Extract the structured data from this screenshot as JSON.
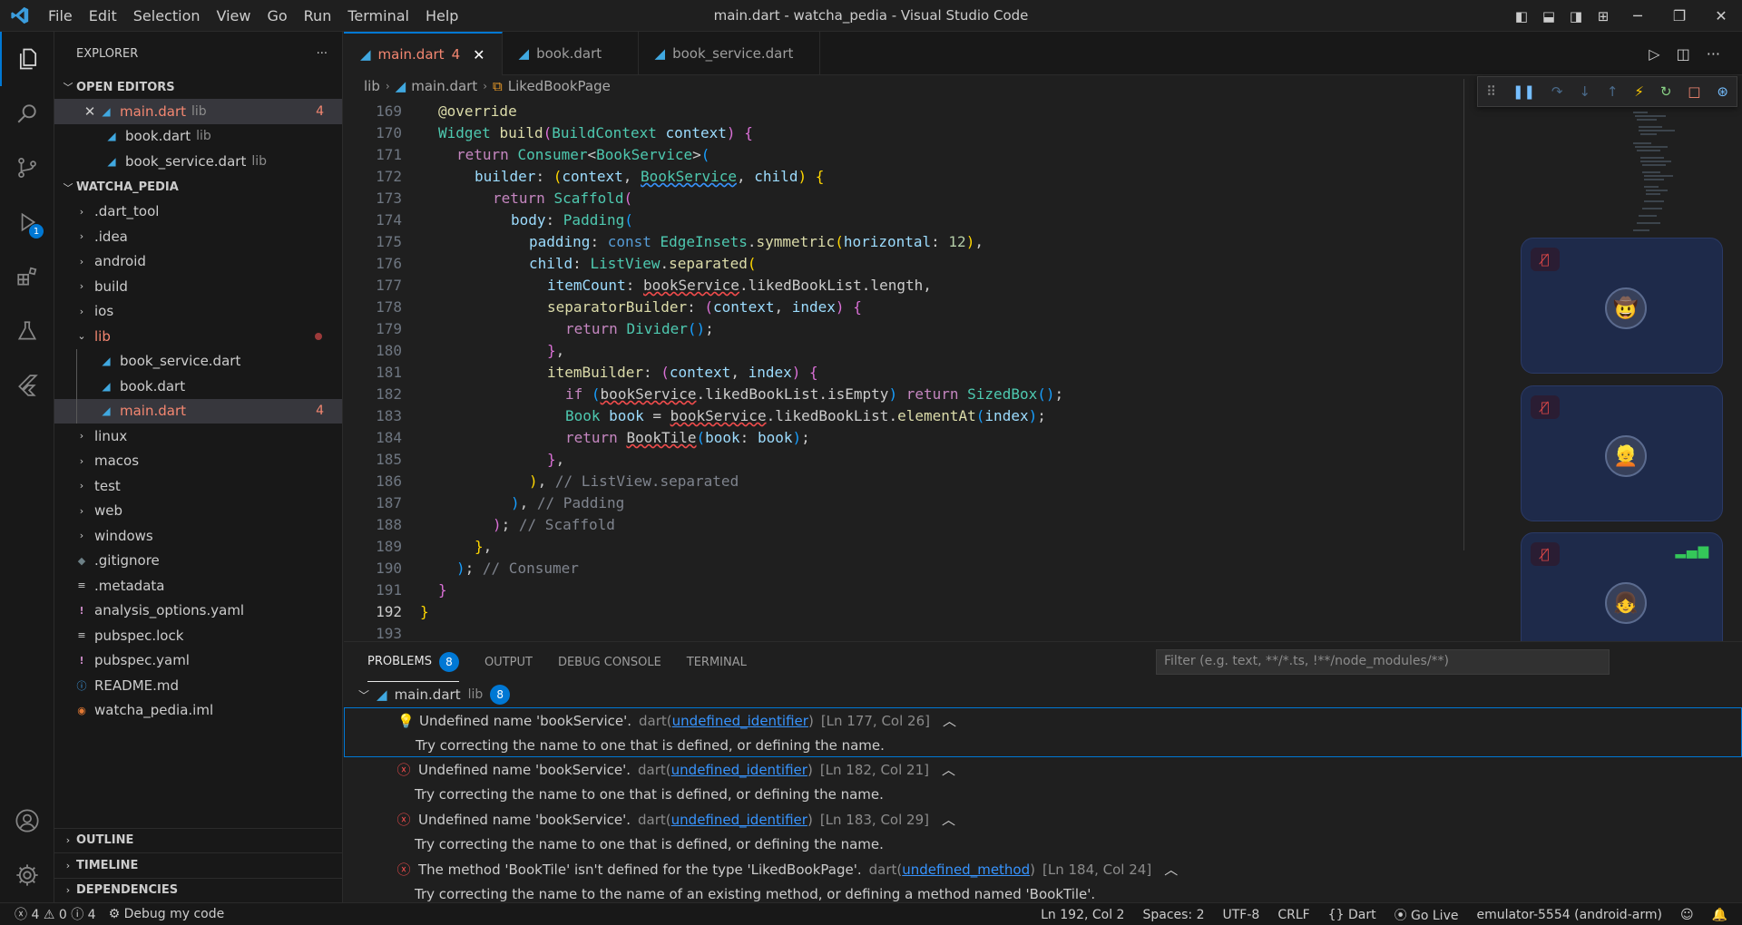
{
  "window": {
    "title": "main.dart - watcha_pedia - Visual Studio Code",
    "menu": [
      "File",
      "Edit",
      "Selection",
      "View",
      "Go",
      "Run",
      "Terminal",
      "Help"
    ]
  },
  "activity": {
    "debug_badge": "1"
  },
  "explorer": {
    "header": "EXPLORER",
    "more": "···",
    "open_editors": {
      "title": "OPEN EDITORS",
      "items": [
        {
          "name": "main.dart",
          "dir": "lib",
          "count": "4",
          "state": "error"
        },
        {
          "name": "book.dart",
          "dir": "lib"
        },
        {
          "name": "book_service.dart",
          "dir": "lib"
        }
      ]
    },
    "project": {
      "title": "WATCHA_PEDIA",
      "items": [
        {
          "name": ".dart_tool"
        },
        {
          "name": ".idea"
        },
        {
          "name": "android"
        },
        {
          "name": "build"
        },
        {
          "name": "ios"
        },
        {
          "name": "lib"
        },
        {
          "name": "book_service.dart"
        },
        {
          "name": "book.dart"
        },
        {
          "name": "main.dart",
          "count": "4"
        },
        {
          "name": "linux"
        },
        {
          "name": "macos"
        },
        {
          "name": "test"
        },
        {
          "name": "web"
        },
        {
          "name": "windows"
        },
        {
          "name": ".gitignore"
        },
        {
          "name": ".metadata"
        },
        {
          "name": "analysis_options.yaml"
        },
        {
          "name": "pubspec.lock"
        },
        {
          "name": "pubspec.yaml"
        },
        {
          "name": "README.md"
        },
        {
          "name": "watcha_pedia.iml"
        }
      ]
    },
    "bottom_sections": [
      "OUTLINE",
      "TIMELINE",
      "DEPENDENCIES"
    ]
  },
  "tabs": [
    {
      "name": "main.dart",
      "count": "4",
      "active": true
    },
    {
      "name": "book.dart"
    },
    {
      "name": "book_service.dart"
    }
  ],
  "breadcrumb": {
    "folder": "lib",
    "file": "main.dart",
    "symbol": "LikedBookPage"
  },
  "code": {
    "lines": [
      "169",
      "170",
      "171",
      "172",
      "173",
      "174",
      "175",
      "176",
      "177",
      "178",
      "179",
      "180",
      "181",
      "182",
      "183",
      "184",
      "185",
      "186",
      "187",
      "188",
      "189",
      "190",
      "191",
      "192",
      "193"
    ],
    "current_line": "192"
  },
  "panel": {
    "tabs": [
      "PROBLEMS",
      "OUTPUT",
      "DEBUG CONSOLE",
      "TERMINAL"
    ],
    "problems_count": "8",
    "filter_placeholder": "Filter (e.g. text, **/*.ts, !**/node_modules/**)",
    "file": {
      "name": "main.dart",
      "dir": "lib",
      "count": "8"
    },
    "problems": [
      {
        "msg": "Undefined name 'bookService'.",
        "src": "dart",
        "code": "undefined_identifier",
        "pos": "[Ln 177, Col 26]",
        "hint": "Try correcting the name to one that is defined, or defining the name."
      },
      {
        "msg": "Undefined name 'bookService'.",
        "src": "dart",
        "code": "undefined_identifier",
        "pos": "[Ln 182, Col 21]",
        "hint": "Try correcting the name to one that is defined, or defining the name."
      },
      {
        "msg": "Undefined name 'bookService'.",
        "src": "dart",
        "code": "undefined_identifier",
        "pos": "[Ln 183, Col 29]",
        "hint": "Try correcting the name to one that is defined, or defining the name."
      },
      {
        "msg": "The method 'BookTile' isn't defined for the type 'LikedBookPage'.",
        "src": "dart",
        "code": "undefined_method",
        "pos": "[Ln 184, Col 24]",
        "hint": "Try correcting the name to the name of an existing method, or defining a method named 'BookTile'."
      }
    ]
  },
  "status": {
    "errors": "4",
    "warnings": "0",
    "infos": "4",
    "debug": "Debug my code",
    "position": "Ln 192, Col 2",
    "spaces": "Spaces: 2",
    "encoding": "UTF-8",
    "eol": "CRLF",
    "language": "Dart",
    "golive": "Go Live",
    "device": "emulator-5554 (android-arm)"
  }
}
